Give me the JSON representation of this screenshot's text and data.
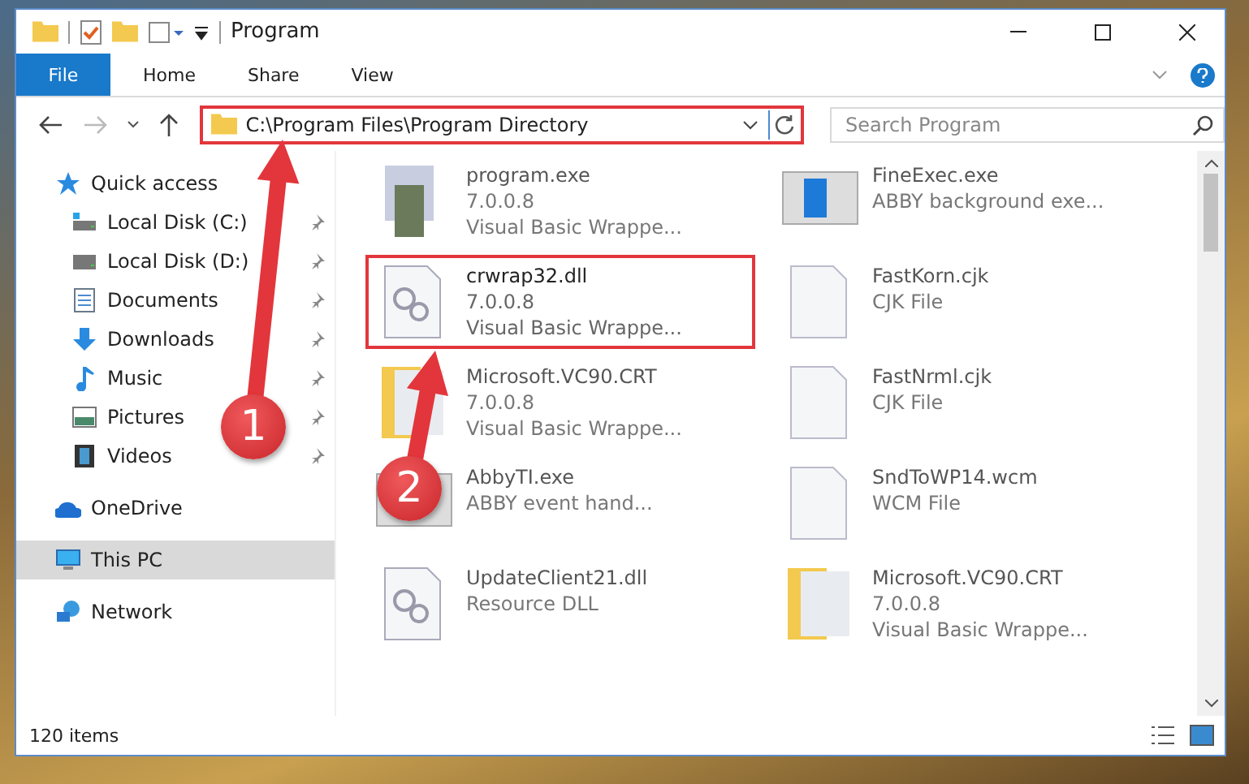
{
  "window": {
    "title": "Program"
  },
  "ribbon": {
    "tabs": [
      {
        "label": "File",
        "kind": "file",
        "selected": false
      },
      {
        "label": "Home",
        "kind": "tab",
        "selected": false
      },
      {
        "label": "Share",
        "kind": "tab",
        "selected": false
      },
      {
        "label": "View",
        "kind": "tab",
        "selected": false
      }
    ]
  },
  "address_bar": {
    "path": "C:\\Program Files\\Program Directory",
    "highlighted": true
  },
  "search": {
    "placeholder": "Search Program"
  },
  "sidebar": {
    "items": [
      {
        "label": "Quick access",
        "kind": "star",
        "selected": false,
        "children": [
          {
            "label": "Local Disk (C:)",
            "kind": "sysdrive",
            "pinned": true,
            "selected": false
          },
          {
            "label": "Local Disk (D:)",
            "kind": "drive",
            "pinned": true,
            "selected": false
          },
          {
            "label": "Documents",
            "kind": "documents",
            "pinned": true,
            "selected": false
          },
          {
            "label": "Downloads",
            "kind": "downloads",
            "pinned": true,
            "selected": false
          },
          {
            "label": "Music",
            "kind": "music",
            "pinned": true,
            "selected": false
          },
          {
            "label": "Pictures",
            "kind": "pictures",
            "pinned": true,
            "selected": false
          },
          {
            "label": "Videos",
            "kind": "videos",
            "pinned": true,
            "selected": false
          }
        ]
      },
      {
        "label": "OneDrive",
        "kind": "cloud",
        "selected": false
      },
      {
        "label": "This PC",
        "kind": "pc",
        "selected": true
      },
      {
        "label": "Network",
        "kind": "network",
        "selected": false
      }
    ]
  },
  "files": [
    {
      "name": "program.exe",
      "details": [
        "7.0.0.8",
        "Visual Basic Wrappe..."
      ],
      "kind": "setup",
      "focused": false
    },
    {
      "name": "FineExec.exe",
      "details": [
        "ABBY background exe..."
      ],
      "kind": "app",
      "focused": false
    },
    {
      "name": "crwrap32.dll",
      "details": [
        "7.0.0.8",
        "Visual Basic Wrappe..."
      ],
      "kind": "dll",
      "focused": true
    },
    {
      "name": "FastKorn.cjk",
      "details": [
        "CJK File"
      ],
      "kind": "blank",
      "focused": false
    },
    {
      "name": "Microsoft.VC90.CRT",
      "details": [
        "7.0.0.8",
        "Visual Basic Wrappe..."
      ],
      "kind": "folder",
      "focused": false
    },
    {
      "name": "FastNrml.cjk",
      "details": [
        "CJK File"
      ],
      "kind": "blank",
      "focused": false
    },
    {
      "name": "AbbyTI.exe",
      "details": [
        "ABBY event hand..."
      ],
      "kind": "app",
      "focused": false
    },
    {
      "name": "SndToWP14.wcm",
      "details": [
        "WCM File"
      ],
      "kind": "blank",
      "focused": false
    },
    {
      "name": "UpdateClient21.dll",
      "details": [
        "Resource DLL"
      ],
      "kind": "dll",
      "focused": false
    },
    {
      "name": "Microsoft.VC90.CRT",
      "details": [
        "7.0.0.8",
        "Visual Basic Wrappe..."
      ],
      "kind": "folder",
      "focused": false
    }
  ],
  "status_bar": {
    "count": "120 items"
  },
  "callouts": [
    {
      "number": "1"
    },
    {
      "number": "2"
    }
  ]
}
